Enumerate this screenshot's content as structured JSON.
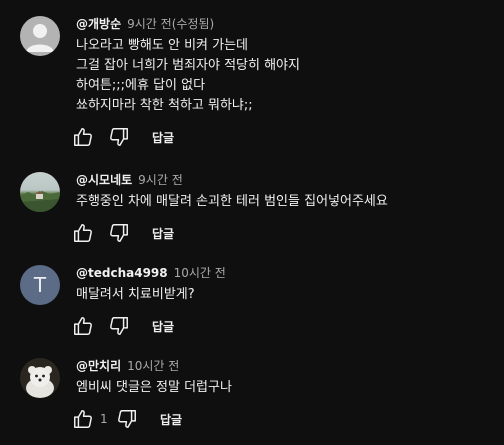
{
  "comments": [
    {
      "author": "@개방순",
      "time": "9시간 전(수정됨)",
      "lines": [
        "나오라고 빵해도 안 비켜 가는데",
        "그걸 잡아 너희가 범죄자야 적당히 해야지",
        "하여튼;;;에휴 답이 없다",
        "쑈하지마라 착한 척하고 뭐하냐;;"
      ],
      "likes": "",
      "reply_label": "답글",
      "avatar": "default-person"
    },
    {
      "author": "@시모네토",
      "time": "9시간 전",
      "lines": [
        "주행중인 차에 매달려 손괴한 테러 범인들 집어넣어주세요"
      ],
      "likes": "",
      "reply_label": "답글",
      "avatar": "landscape-photo"
    },
    {
      "author": "@tedcha4998",
      "time": "10시간 전",
      "lines": [
        "매달려서 치료비받게?"
      ],
      "likes": "",
      "reply_label": "답글",
      "avatar": "T"
    },
    {
      "author": "@만치리",
      "time": "10시간 전",
      "lines": [
        "엠비씨 댓글은 정말 더럽구나"
      ],
      "likes": "1",
      "reply_label": "답글",
      "avatar": "white-dog-photo"
    }
  ]
}
